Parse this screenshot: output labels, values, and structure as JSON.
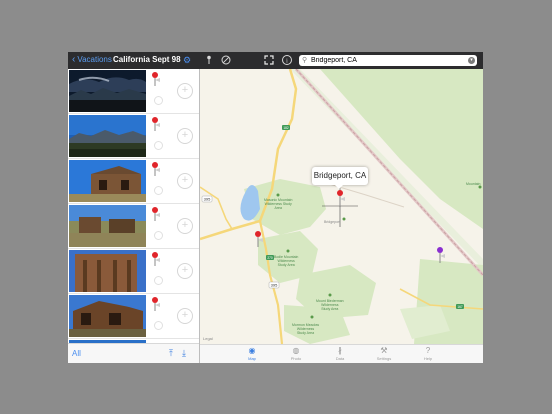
{
  "topbar": {
    "back_label": "Vacations",
    "album_title": "California Sept 98",
    "search_value": "Bridgeport, CA"
  },
  "photos": [
    {
      "subject": "storm clouds over mountains"
    },
    {
      "subject": "blue sky over mountains"
    },
    {
      "subject": "old wooden house"
    },
    {
      "subject": "wooden shacks in field"
    },
    {
      "subject": "weathered wooden building"
    },
    {
      "subject": "old barn"
    },
    {
      "subject": "partial photo"
    }
  ],
  "leftpanel": {
    "all_label": "All"
  },
  "map": {
    "callout": "Bridgeport, CA",
    "legal": "Legal",
    "highways": [
      "395",
      "182",
      "395",
      "270",
      "167"
    ],
    "labels": {
      "masonic": "Masonic Mountain\nWilderness Study\nArea",
      "bridgeport": "Bridgeport",
      "bodie": "Bodie Mountain\nWilderness\nStudy Area",
      "bodie2": "Mount Biederman\nWilderness\nStudy Area",
      "mormon": "Mormon Meadow\nWilderness\nStudy Area",
      "mountain": "Mountain"
    }
  },
  "tabs": [
    {
      "label": "Map",
      "icon": "globe-icon"
    },
    {
      "label": "Photo",
      "icon": "camera-icon"
    },
    {
      "label": "Data",
      "icon": "data-icon"
    },
    {
      "label": "Settings",
      "icon": "wrench-icon"
    },
    {
      "label": "Help",
      "icon": "question-icon"
    }
  ],
  "colors": {
    "accent": "#3a7ee0",
    "red_pin": "#e0252b",
    "purple_pin": "#8a2ed0",
    "map_bg": "#f6f3ea",
    "park_green": "#d7e8c2",
    "road_yellow": "#f5d77a",
    "water": "#9fc7ef"
  }
}
